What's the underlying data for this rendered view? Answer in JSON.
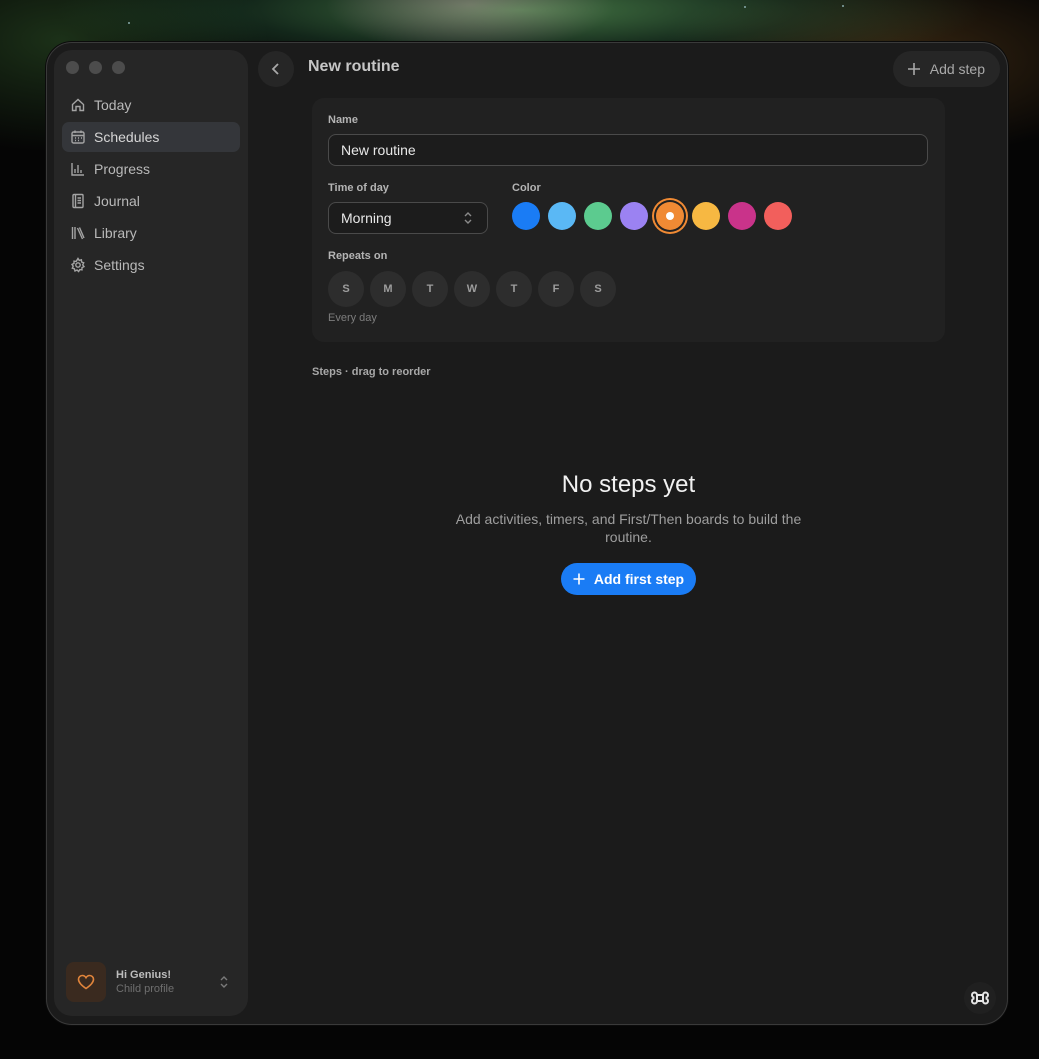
{
  "window": {
    "title": "New routine"
  },
  "sidebar": {
    "items": [
      {
        "label": "Today",
        "icon": "home-icon",
        "active": false
      },
      {
        "label": "Schedules",
        "icon": "calendar-icon",
        "active": true
      },
      {
        "label": "Progress",
        "icon": "bar-chart-icon",
        "active": false
      },
      {
        "label": "Journal",
        "icon": "notebook-icon",
        "active": false
      },
      {
        "label": "Library",
        "icon": "books-icon",
        "active": false
      },
      {
        "label": "Settings",
        "icon": "gear-icon",
        "active": false
      }
    ],
    "profile": {
      "name": "Hi Genius!",
      "subtitle": "Child profile",
      "icon": "heart-icon"
    }
  },
  "header": {
    "back_icon": "chevron-left-icon",
    "add_step_label": "Add step"
  },
  "form": {
    "name_label": "Name",
    "name_value": "New routine",
    "time_label": "Time of day",
    "time_value": "Morning",
    "color_label": "Color",
    "colors": [
      "#1a7cf5",
      "#5ab8f5",
      "#5ccb8f",
      "#9b82f2",
      "#f08a34",
      "#f7b842",
      "#c9338a",
      "#f25f5c"
    ],
    "selected_color": "#f08a34",
    "repeats_label": "Repeats on",
    "days": [
      "S",
      "M",
      "T",
      "W",
      "T",
      "F",
      "S"
    ],
    "repeats_hint": "Every day"
  },
  "steps": {
    "header": "Steps · drag to reorder",
    "empty_title": "No steps yet",
    "empty_description": "Add activities, timers, and First/Then boards to build the routine.",
    "add_first_label": "Add first step"
  }
}
